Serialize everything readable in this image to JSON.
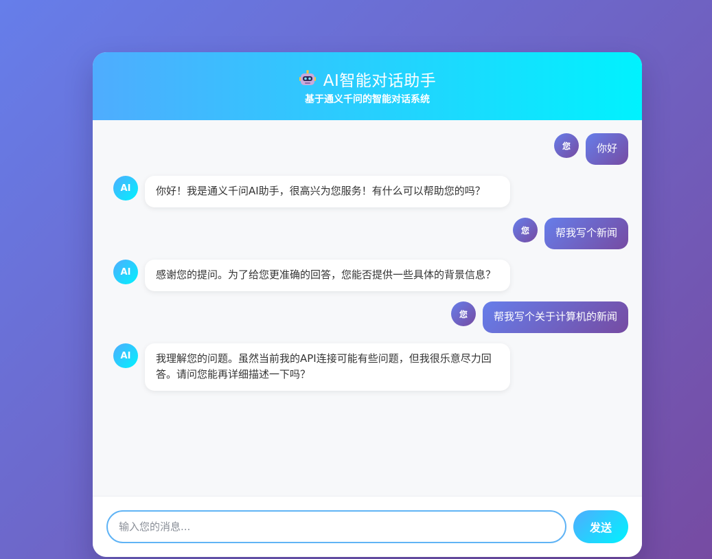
{
  "header": {
    "icon": "robot-icon",
    "title": "AI智能对话助手",
    "subtitle": "基于通义千问的智能对话系统"
  },
  "messages": [
    {
      "role": "user",
      "avatar": "您",
      "text": "你好"
    },
    {
      "role": "ai",
      "avatar": "AI",
      "text": "你好！我是通义千问AI助手，很高兴为您服务！有什么可以帮助您的吗？"
    },
    {
      "role": "user",
      "avatar": "您",
      "text": "帮我写个新闻"
    },
    {
      "role": "ai",
      "avatar": "AI",
      "text": "感谢您的提问。为了给您更准确的回答，您能否提供一些具体的背景信息？"
    },
    {
      "role": "user",
      "avatar": "您",
      "text": "帮我写个关于计算机的新闻"
    },
    {
      "role": "ai",
      "avatar": "AI",
      "text": "我理解您的问题。虽然当前我的API连接可能有些问题，但我很乐意尽力回答。请问您能再详细描述一下吗？"
    }
  ],
  "composer": {
    "placeholder": "输入您的消息...",
    "value": "",
    "send_label": "发送"
  },
  "colors": {
    "page_gradient": [
      "#667eea",
      "#764ba2"
    ],
    "header_gradient": [
      "#4facfe",
      "#00f2fe"
    ],
    "user_bubble": [
      "#667eea",
      "#764ba2"
    ],
    "chat_background": "#f7f8fa"
  }
}
